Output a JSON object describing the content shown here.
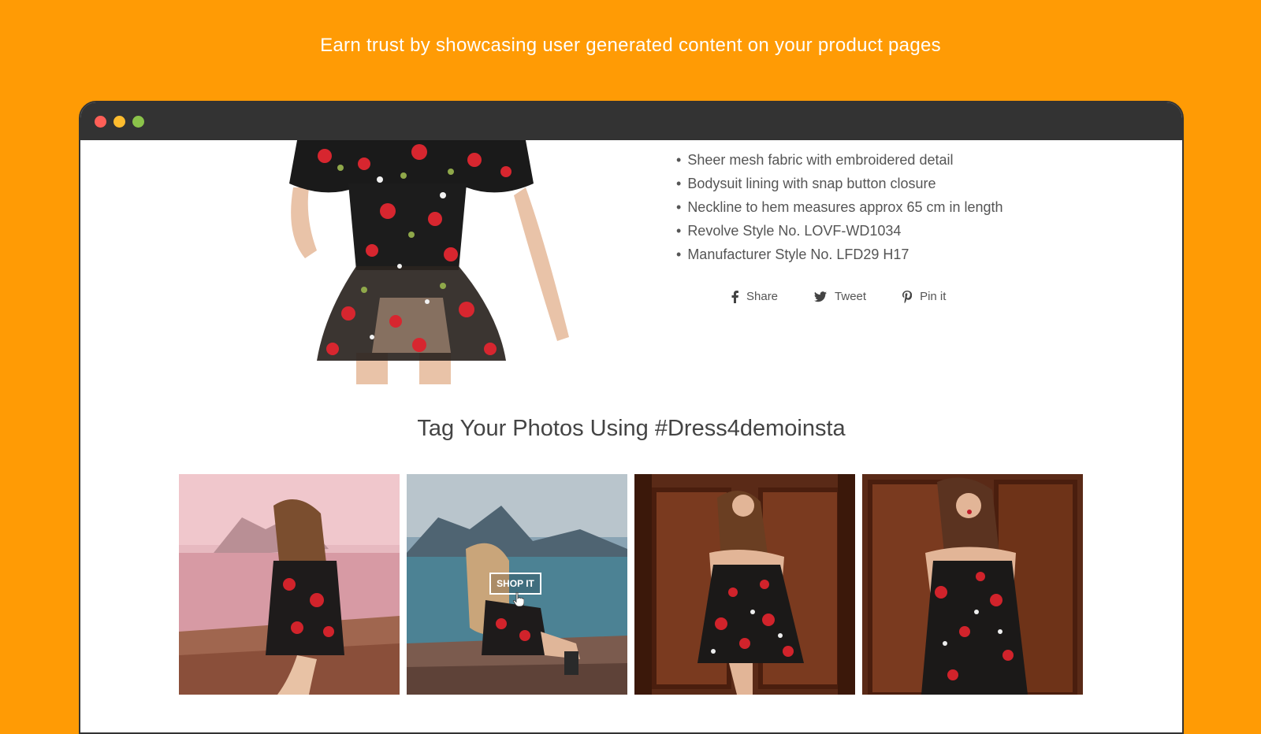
{
  "headline": "Earn trust by showcasing user generated content on your product pages",
  "window": {
    "traffic_lights": [
      "#FF5F57",
      "#FEBC2E",
      "#8BC34A"
    ]
  },
  "product": {
    "details": [
      "Sheer mesh fabric with embroidered detail",
      "Bodysuit lining with snap button closure",
      "Neckline to hem measures approx 65 cm in length",
      "Revolve Style No. LOVF-WD1034",
      "Manufacturer Style No. LFD29 H17"
    ],
    "share": [
      {
        "label": "Share",
        "icon": "facebook-icon"
      },
      {
        "label": "Tweet",
        "icon": "twitter-icon"
      },
      {
        "label": "Pin it",
        "icon": "pinterest-icon"
      }
    ]
  },
  "gallery": {
    "title": "Tag Your Photos Using #Dress4demoinsta",
    "shop_label": "SHOP IT"
  },
  "colors": {
    "background": "#FF9B05",
    "titlebar": "#333333",
    "text": "#555555"
  }
}
